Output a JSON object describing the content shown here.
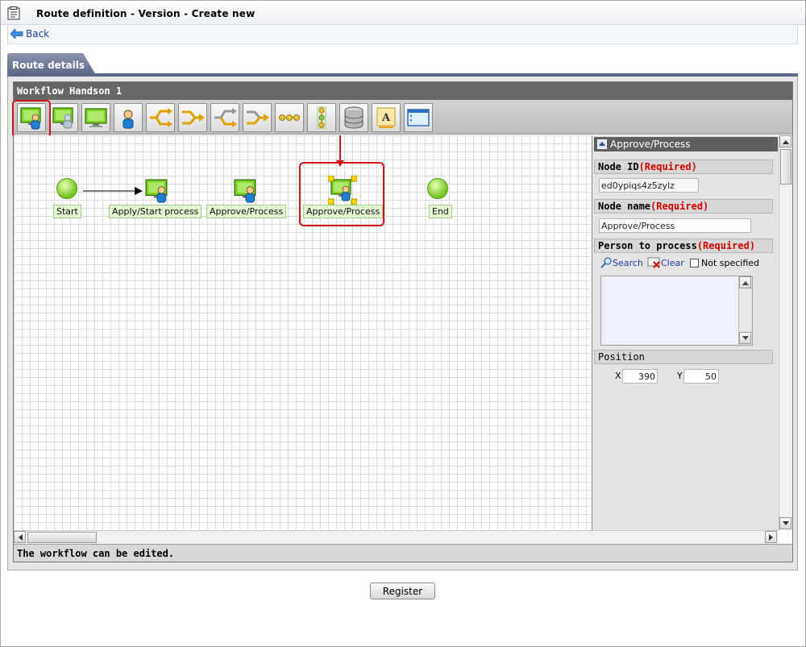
{
  "window": {
    "title": "Route definition - Version - Create new"
  },
  "nav": {
    "back_label": "Back"
  },
  "tab": {
    "label": "Route details"
  },
  "editor": {
    "title": "Workflow Handson 1",
    "status": "The workflow can be edited.",
    "toolbar": [
      "user-node-icon",
      "multi-user-node-icon",
      "system-node-icon",
      "person-icon",
      "branch-merge-icon",
      "split-arrow-icon",
      "branch-arrow-icon",
      "join-arrow-icon",
      "chain-dots-icon",
      "vertical-chain-icon",
      "database-icon",
      "text-label-icon",
      "form-window-icon"
    ],
    "nodes": {
      "start": "Start",
      "apply": "Apply/Start process",
      "approve1": "Approve/Process",
      "approve2": "Approve/Process",
      "end": "End"
    }
  },
  "props": {
    "header": "Approve/Process",
    "node_id_label": "Node ID",
    "node_id_required": "(Required)",
    "node_id_value": "ed0ypiqs4z5zylz",
    "node_name_label": "Node name",
    "node_name_required": "(Required)",
    "node_name_value": "Approve/Process",
    "person_label": "Person to process",
    "person_required": "(Required)",
    "search_label": "Search",
    "clear_label": "Clear",
    "not_specified_label": "Not specified",
    "position_label": "Position",
    "x_label": "X",
    "x_value": "390",
    "y_label": "Y",
    "y_value": "50"
  },
  "footer": {
    "register_label": "Register"
  },
  "colors": {
    "highlight": "#d0141b",
    "required": "#d40000",
    "tab": "#5e6987"
  }
}
